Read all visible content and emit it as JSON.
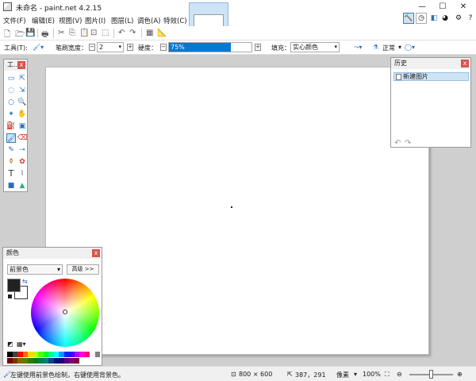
{
  "window": {
    "title": "未命名 - paint.net 4.2.15",
    "min": "—",
    "max": "☐",
    "close": "✕"
  },
  "menu": [
    {
      "label": "文件(F)"
    },
    {
      "label": "编辑(E)"
    },
    {
      "label": "视图(V)"
    },
    {
      "label": "图片(I)"
    },
    {
      "label": "图层(L)"
    },
    {
      "label": "调色(A)"
    },
    {
      "label": "特效(C)"
    }
  ],
  "toolbar2": {
    "tool_label": "工具(T):",
    "brush_width_label": "笔刷宽度：",
    "brush_width_value": "2",
    "hardness_label": "硬度：",
    "hardness_value": "75%",
    "hardness_fraction": 0.75,
    "fill_label": "填充：",
    "fill_value": "实心颜色",
    "blend_value": "正常"
  },
  "tools_panel": {
    "title": "工...",
    "close": "x"
  },
  "history_panel": {
    "title": "历史",
    "close": "x",
    "items": [
      "新建图片"
    ]
  },
  "colors_panel": {
    "title": "颜色",
    "close": "x",
    "primary_select": "前景色",
    "more_button": "高级 >>",
    "primary_color": "#222222",
    "secondary_color": "#ffffff",
    "palette": [
      "#000000",
      "#404040",
      "#ff0000",
      "#ff6a00",
      "#ffd800",
      "#b6ff00",
      "#4cff00",
      "#00ff21",
      "#00ff90",
      "#00ffff",
      "#0094ff",
      "#0026ff",
      "#4800ff",
      "#b200ff",
      "#ff00dc",
      "#ff006e",
      "#ffffff",
      "#808080",
      "#7f0000",
      "#7f3300",
      "#7f6a00",
      "#5b7f00",
      "#267f00",
      "#007f0e",
      "#007f46",
      "#007f7f",
      "#004a7f",
      "#00137f",
      "#21007f",
      "#57007f",
      "#7f006e",
      "#7f0037"
    ]
  },
  "statusbar": {
    "hint": "左键使用前景色绘制，右键使用背景色。",
    "image_size": "800 × 600",
    "cursor_pos": "387，291",
    "units": "像素",
    "zoom": "100%"
  }
}
